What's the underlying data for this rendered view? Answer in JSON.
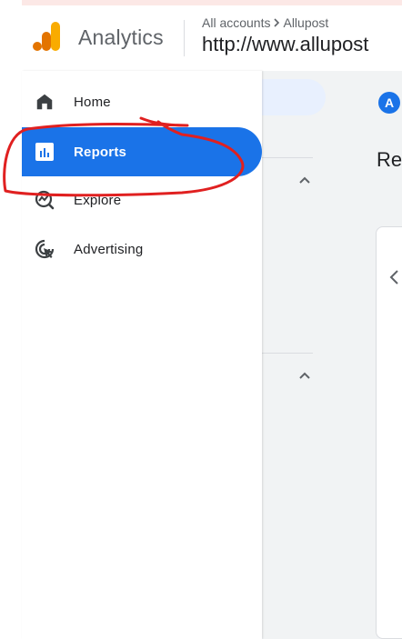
{
  "app": {
    "title": "Analytics",
    "brand_colors": {
      "bar_dark": "#e37400",
      "bar_light": "#f9ab00"
    }
  },
  "breadcrumb": {
    "items": [
      "All accounts",
      "Allupost"
    ]
  },
  "property": {
    "url": "http://www.allupost"
  },
  "nav": {
    "items": [
      {
        "label": "Home",
        "icon": "home-icon",
        "active": false
      },
      {
        "label": "Reports",
        "icon": "reports-icon",
        "active": true
      },
      {
        "label": "Explore",
        "icon": "explore-icon",
        "active": false
      },
      {
        "label": "Advertising",
        "icon": "advertising-icon",
        "active": false
      }
    ],
    "active_color": "#1a73e8"
  },
  "main": {
    "avatar_letter": "A",
    "heading_fragment": "Re"
  },
  "annotation": {
    "color": "#e02020",
    "target": "Reports"
  }
}
